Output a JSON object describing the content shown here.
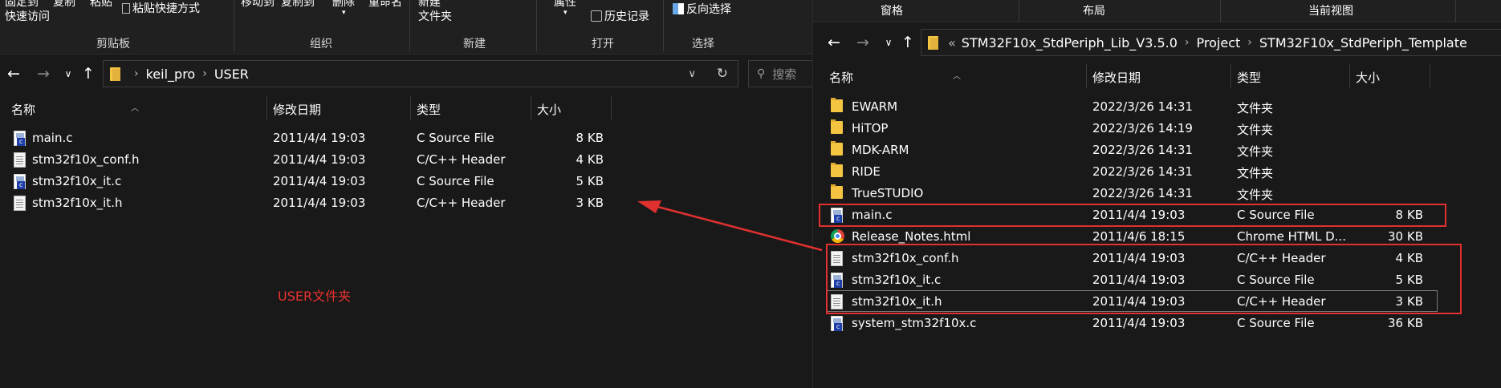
{
  "left": {
    "ribbon": {
      "pin_label_line1": "固定到",
      "pin_label_line2": "快速访问",
      "copy_label": "复制",
      "paste_label": "粘贴",
      "paste_shortcut_label": "粘贴快捷方式",
      "move_to_label": "移动到",
      "copy_to_label": "复制到",
      "delete_label": "删除",
      "rename_label": "重命名",
      "new_folder_line1": "新建",
      "new_folder_line2": "文件夹",
      "properties_label": "属性",
      "history_label": "历史记录",
      "invert_selection_label": "反向选择",
      "groups": [
        "剪贴板",
        "组织",
        "新建",
        "打开",
        "选择"
      ]
    },
    "breadcrumbs": [
      "keil_pro",
      "USER"
    ],
    "search_placeholder": "搜索",
    "columns": {
      "name": "名称",
      "date": "修改日期",
      "type": "类型",
      "size": "大小"
    },
    "files": [
      {
        "icon": "c-source-icon",
        "name": "main.c",
        "date": "2011/4/4 19:03",
        "type": "C Source File",
        "size": "8 KB"
      },
      {
        "icon": "header-file-icon",
        "name": "stm32f10x_conf.h",
        "date": "2011/4/4 19:03",
        "type": "C/C++ Header",
        "size": "4 KB"
      },
      {
        "icon": "c-source-icon",
        "name": "stm32f10x_it.c",
        "date": "2011/4/4 19:03",
        "type": "C Source File",
        "size": "5 KB"
      },
      {
        "icon": "header-file-icon",
        "name": "stm32f10x_it.h",
        "date": "2011/4/4 19:03",
        "type": "C/C++ Header",
        "size": "3 KB"
      }
    ],
    "annotation_label": "USER文件夹"
  },
  "right": {
    "ribbon": {
      "tabs": [
        "窗格",
        "布局",
        "当前视图"
      ]
    },
    "breadcrumbs": [
      "STM32F10x_StdPeriph_Lib_V3.5.0",
      "Project",
      "STM32F10x_StdPeriph_Template"
    ],
    "breadcrumb_overflow": "«",
    "columns": {
      "name": "名称",
      "date": "修改日期",
      "type": "类型",
      "size": "大小"
    },
    "files": [
      {
        "icon": "folder-icon",
        "name": "EWARM",
        "date": "2022/3/26 14:31",
        "type": "文件夹",
        "size": ""
      },
      {
        "icon": "folder-icon",
        "name": "HiTOP",
        "date": "2022/3/26 14:19",
        "type": "文件夹",
        "size": ""
      },
      {
        "icon": "folder-icon",
        "name": "MDK-ARM",
        "date": "2022/3/26 14:31",
        "type": "文件夹",
        "size": ""
      },
      {
        "icon": "folder-icon",
        "name": "RIDE",
        "date": "2022/3/26 14:31",
        "type": "文件夹",
        "size": ""
      },
      {
        "icon": "folder-icon",
        "name": "TrueSTUDIO",
        "date": "2022/3/26 14:31",
        "type": "文件夹",
        "size": ""
      },
      {
        "icon": "c-source-icon",
        "name": "main.c",
        "date": "2011/4/4 19:03",
        "type": "C Source File",
        "size": "8 KB"
      },
      {
        "icon": "chrome-html-icon",
        "name": "Release_Notes.html",
        "date": "2011/4/6 18:15",
        "type": "Chrome HTML D...",
        "size": "30 KB"
      },
      {
        "icon": "header-file-icon",
        "name": "stm32f10x_conf.h",
        "date": "2011/4/4 19:03",
        "type": "C/C++ Header",
        "size": "4 KB"
      },
      {
        "icon": "c-source-icon",
        "name": "stm32f10x_it.c",
        "date": "2011/4/4 19:03",
        "type": "C Source File",
        "size": "5 KB"
      },
      {
        "icon": "header-file-icon",
        "name": "stm32f10x_it.h",
        "date": "2011/4/4 19:03",
        "type": "C/C++ Header",
        "size": "3 KB"
      },
      {
        "icon": "c-source-icon",
        "name": "system_stm32f10x.c",
        "date": "2011/4/4 19:03",
        "type": "C Source File",
        "size": "36 KB"
      }
    ]
  },
  "colors": {
    "background": "#191919",
    "ribbon": "#202020",
    "highlight": "#e03030",
    "folder": "#f5c542"
  },
  "icons": {
    "back": "left-arrow-icon",
    "forward": "right-arrow-icon",
    "recent": "chevron-down-icon",
    "up": "up-arrow-icon",
    "refresh": "refresh-icon",
    "search": "search-icon"
  }
}
